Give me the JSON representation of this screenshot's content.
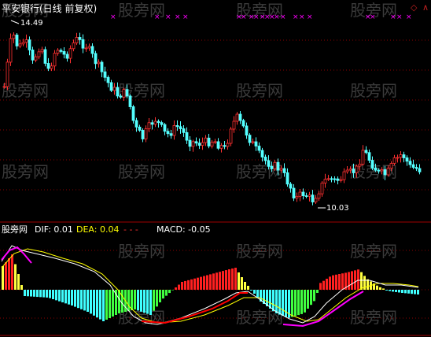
{
  "price_panel": {
    "title": "平安银行(日线 前复权)",
    "high_label": "14.49",
    "low_label": "10.03",
    "marker_glyph": "×",
    "marker_color": "#ff00ff",
    "up_color": "#ff3030",
    "down_color": "#54ffff",
    "grid_color": "#8b0000"
  },
  "macd_panel": {
    "name": "股旁网",
    "dif_label": "DIF: 0.01",
    "dea_label": "DEA: 0.04",
    "sep_label": "- - -",
    "macd_label": "MACD: -0.05",
    "dif_color": "#ffffff",
    "dea_color": "#ffff00",
    "macd_line_colors": [
      "#ff0000",
      "#ff00ff"
    ]
  },
  "watermark": "股旁网",
  "corner_icon": "diamond-icon"
}
